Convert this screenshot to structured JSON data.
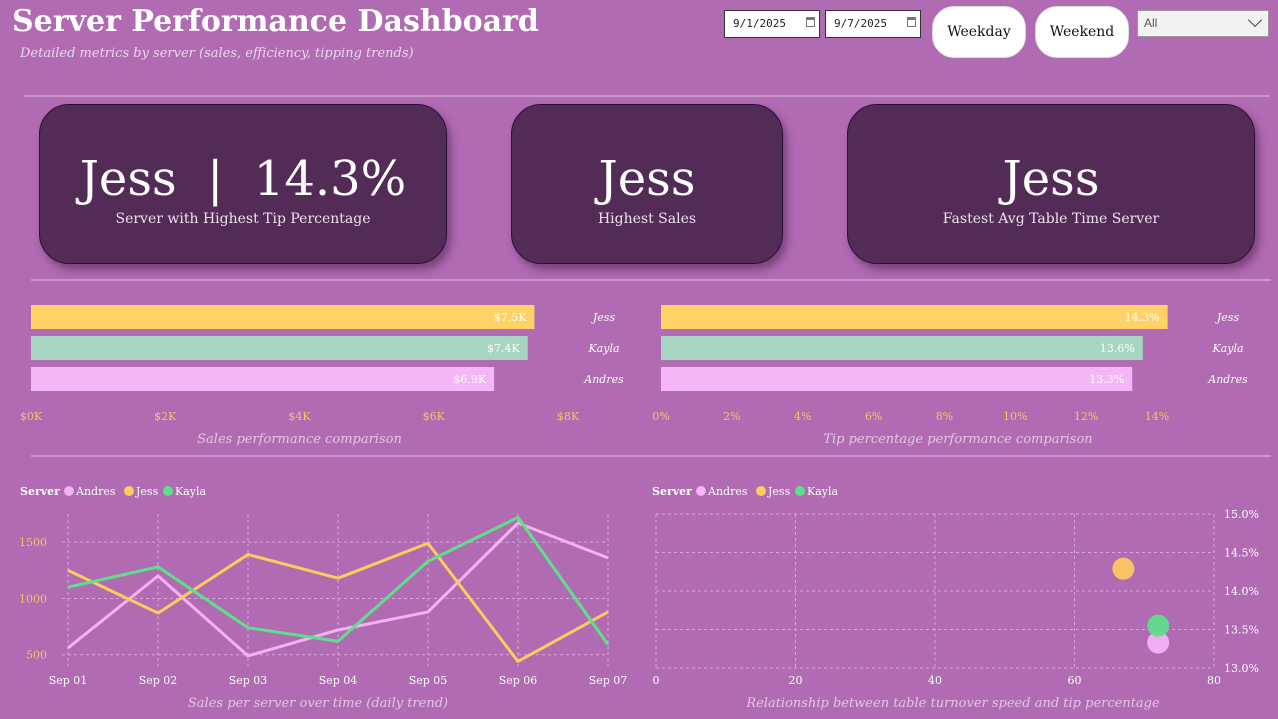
{
  "header": {
    "title": "Server Performance Dashboard",
    "subtitle": "Detailed metrics by server (sales, efficiency, tipping trends)"
  },
  "filters": {
    "start_date": "9/1/2025",
    "end_date": "9/7/2025",
    "weekday_label": "Weekday",
    "weekend_label": "Weekend",
    "server_select_value": "All"
  },
  "kpis": [
    {
      "value": "Jess  |  14.3%",
      "label": "Server with Highest Tip Percentage"
    },
    {
      "value": "Jess",
      "label": "Highest Sales"
    },
    {
      "value": "Jess",
      "label": "Fastest Avg Table Time Server"
    }
  ],
  "colors": {
    "jess": "#ffd166",
    "kayla": "#a8d5c2",
    "andres": "#f4b6f6",
    "line_andres": "#f6b0f4",
    "line_jess": "#ffcb5c",
    "line_kayla": "#5ee08a",
    "kpi_bg": "#522b57",
    "page_bg": "#b06bb2"
  },
  "chart_data": [
    {
      "type": "bar",
      "orientation": "horizontal",
      "caption": "Sales performance comparison",
      "categories": [
        "Jess",
        "Kayla",
        "Andres"
      ],
      "values": [
        7500,
        7400,
        6900
      ],
      "value_labels": [
        "$7.5K",
        "$7.4K",
        "$6.9K"
      ],
      "x_ticks": [
        "$0K",
        "$2K",
        "$4K",
        "$6K",
        "$8K"
      ],
      "xlim": [
        0,
        8000
      ],
      "colors": [
        "#ffd166",
        "#a8d5c2",
        "#f4b6f6"
      ]
    },
    {
      "type": "bar",
      "orientation": "horizontal",
      "caption": "Tip percentage performance comparison",
      "categories": [
        "Jess",
        "Kayla",
        "Andres"
      ],
      "values": [
        14.3,
        13.6,
        13.3
      ],
      "value_labels": [
        "14.3%",
        "13.6%",
        "13.3%"
      ],
      "x_ticks": [
        "0%",
        "2%",
        "4%",
        "6%",
        "8%",
        "10%",
        "12%",
        "14%"
      ],
      "xlim": [
        0,
        14
      ],
      "colors": [
        "#ffd166",
        "#a8d5c2",
        "#f4b6f6"
      ]
    },
    {
      "type": "line",
      "caption": "Sales per server over time (daily trend)",
      "legend_title": "Server",
      "x": [
        "Sep 01",
        "Sep 02",
        "Sep 03",
        "Sep 04",
        "Sep 05",
        "Sep 06",
        "Sep 07"
      ],
      "y_ticks": [
        "500",
        "1000",
        "1500"
      ],
      "ylim": [
        400,
        1750
      ],
      "grid": true,
      "series": [
        {
          "name": "Andres",
          "color": "#f6b0f4",
          "values": [
            560,
            1200,
            490,
            720,
            880,
            1670,
            1360
          ]
        },
        {
          "name": "Jess",
          "color": "#ffcb5c",
          "values": [
            1250,
            870,
            1390,
            1180,
            1490,
            440,
            880
          ]
        },
        {
          "name": "Kayla",
          "color": "#5ee08a",
          "values": [
            1100,
            1280,
            740,
            620,
            1330,
            1720,
            590
          ]
        }
      ]
    },
    {
      "type": "scatter",
      "caption": "Relationship between table turnover speed and tip percentage",
      "legend_title": "Server",
      "x_ticks": [
        "0",
        "20",
        "40",
        "60",
        "80"
      ],
      "y_ticks": [
        "13.0%",
        "13.5%",
        "14.0%",
        "14.5%",
        "15.0%"
      ],
      "xlim": [
        0,
        80
      ],
      "ylim": [
        13.0,
        15.0
      ],
      "grid": true,
      "series": [
        {
          "name": "Andres",
          "color": "#f4b6f6",
          "x": 72,
          "y": 13.33
        },
        {
          "name": "Jess",
          "color": "#ffcb5c",
          "x": 67,
          "y": 14.29
        },
        {
          "name": "Kayla",
          "color": "#5ee08a",
          "x": 72,
          "y": 13.55
        }
      ]
    }
  ]
}
